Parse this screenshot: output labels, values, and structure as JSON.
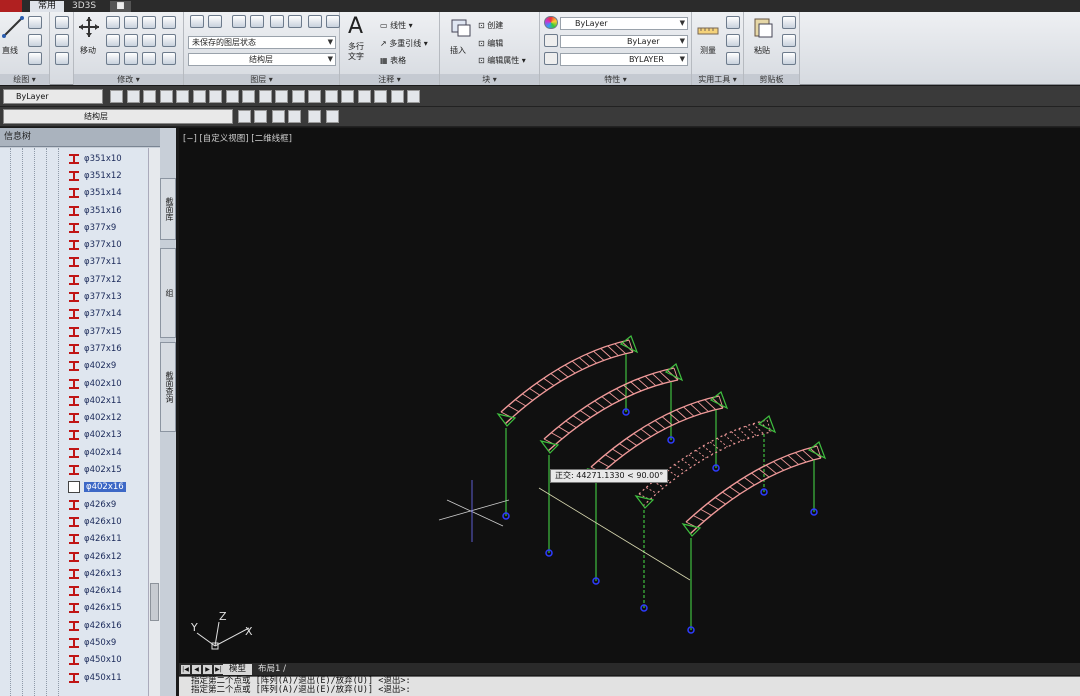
{
  "tabs": {
    "home": "常用",
    "three_d": "3D3S",
    "mini": "■"
  },
  "ribbon": {
    "draw": {
      "line_label": "直线",
      "title": "绘图 ▾"
    },
    "modify": {
      "move_label": "移动",
      "title": "修改 ▾"
    },
    "layers": {
      "layer_state": "未保存的图层状态",
      "current_layer": "结构层",
      "title": "图层 ▾"
    },
    "annotation": {
      "text_label": "多行\n文字",
      "dim_label": "线性",
      "leader_label": "多重引线",
      "table_label": "表格",
      "title": "注释 ▾"
    },
    "block": {
      "insert_label": "插入",
      "create_label": "创建",
      "edit_label": "编辑",
      "attr_label": "编辑属性",
      "title": "块 ▾"
    },
    "properties": {
      "color": "ByLayer",
      "linetype": "ByLayer",
      "lineweight": "BYLAYER",
      "title": "特性 ▾"
    },
    "utilities": {
      "measure_label": "测量",
      "title": "实用工具 ▾"
    },
    "clipboard": {
      "paste_label": "粘贴",
      "title": "剪贴板"
    }
  },
  "toolbar": {
    "layer_combo": "ByLayer",
    "layer_name": "结构层"
  },
  "palette": {
    "title": "信息树",
    "items": [
      "φ351x10",
      "φ351x12",
      "φ351x14",
      "φ351x16",
      "φ377x9",
      "φ377x10",
      "φ377x11",
      "φ377x12",
      "φ377x13",
      "φ377x14",
      "φ377x15",
      "φ377x16",
      "φ402x9",
      "φ402x10",
      "φ402x11",
      "φ402x12",
      "φ402x13",
      "φ402x14",
      "φ402x15",
      "φ402x16",
      "φ426x9",
      "φ426x10",
      "φ426x11",
      "φ426x12",
      "φ426x13",
      "φ426x14",
      "φ426x15",
      "φ426x16",
      "φ450x9",
      "φ450x10",
      "φ450x11"
    ],
    "selected_index": 19,
    "side_tabs": [
      "截面库",
      "组",
      "截面查询"
    ]
  },
  "viewport": {
    "label": "[−] [自定义视图] [二维线框]",
    "coord_tip": "正交: 44271.1330 < 90.00°",
    "axis_x": "X",
    "axis_y": "Y",
    "axis_z": "Z"
  },
  "model_tabs": {
    "model": "模型",
    "layout1": "布局1 /"
  },
  "command_lines": [
    "指定第二个点或 [阵列(A)/退出(E)/放弃(U)] <退出>:",
    "指定第二个点或 [阵列(A)/退出(E)/放弃(U)] <退出>:"
  ],
  "colors": {
    "truss": "#f09a9a",
    "support": "#3fbf3f",
    "base": "#2d3cff"
  }
}
